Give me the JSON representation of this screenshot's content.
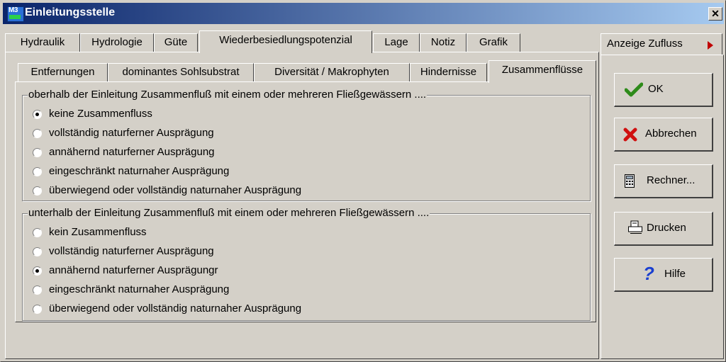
{
  "window": {
    "title": "Einleitungsstelle",
    "app_icon": {
      "text": "M3",
      "name": "app-icon"
    },
    "close_symbol": "✕"
  },
  "tabs": [
    {
      "label": "Hydraulik"
    },
    {
      "label": "Hydrologie"
    },
    {
      "label": "Güte"
    },
    {
      "label": "Wiederbesiedlungspotenzial",
      "active": true
    },
    {
      "label": "Lage"
    },
    {
      "label": "Notiz"
    },
    {
      "label": "Grafik"
    }
  ],
  "subtabs": [
    {
      "label": "Entfernungen"
    },
    {
      "label": "dominantes Sohlsubstrat"
    },
    {
      "label": "Diversität / Makrophyten"
    },
    {
      "label": "Hindernisse"
    },
    {
      "label": "Zusammenflüsse",
      "active": true
    }
  ],
  "side_tab": {
    "label": "Anzeige Zufluss",
    "icon": "triangle-right-icon",
    "icon_color": "#c00000"
  },
  "group_upper": {
    "legend": "oberhalb der Einleitung Zusammenfluß mit einem oder mehreren Fließgewässern ....",
    "options": [
      {
        "label": "keine Zusammenfluss",
        "checked": true
      },
      {
        "label": "vollständig naturferner Ausprägung",
        "checked": false
      },
      {
        "label": "annähernd naturferner Ausprägung",
        "checked": false
      },
      {
        "label": "eingeschränkt naturnaher Ausprägung",
        "checked": false
      },
      {
        "label": "überwiegend oder vollständig naturnaher Ausprägung",
        "checked": false
      }
    ]
  },
  "group_lower": {
    "legend": "unterhalb der Einleitung Zusammenfluß mit einem oder mehreren Fließgewässern ....",
    "options": [
      {
        "label": "kein Zusammenfluss",
        "checked": false
      },
      {
        "label": "vollständig naturferner Ausprägung",
        "checked": false
      },
      {
        "label": "annähernd naturferner Ausprägungr",
        "checked": true
      },
      {
        "label": "eingeschränkt naturnaher Ausprägung",
        "checked": false
      },
      {
        "label": "überwiegend oder vollständig naturnaher Ausprägung",
        "checked": false
      }
    ]
  },
  "buttons": {
    "ok": {
      "label": "OK",
      "icon": "checkmark-icon",
      "color": "#2e8b1a"
    },
    "cancel": {
      "label": "Abbrechen",
      "icon": "x-icon",
      "color": "#d01010"
    },
    "calculator": {
      "label": "Rechner...",
      "icon": "calculator-icon"
    },
    "print": {
      "label": "Drucken",
      "icon": "printer-icon"
    },
    "help": {
      "label": "Hilfe",
      "icon": "question-icon",
      "color": "#1a3fd0"
    }
  },
  "colors": {
    "face": "#d4d0c8",
    "title_start": "#0a246a",
    "title_end": "#a6caf0"
  }
}
